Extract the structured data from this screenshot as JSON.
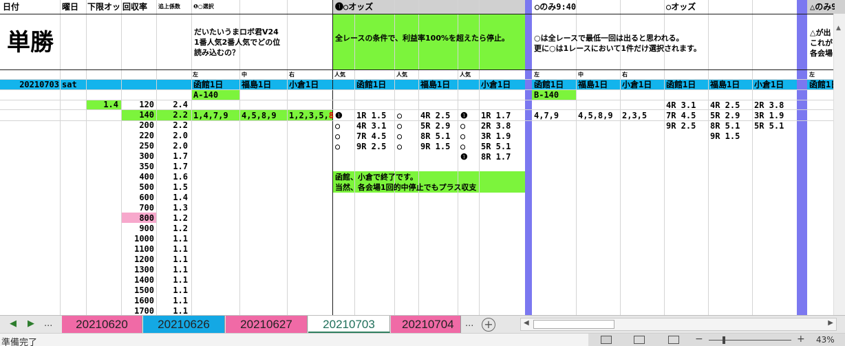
{
  "headers": {
    "date": "日付",
    "weekday": "曜日",
    "lower_limit": "下限オッ",
    "recovery": "回収率",
    "coef": "追上係数",
    "selection1": "❶○選択",
    "odds1": "❶○オッズ",
    "only940": "○のみ9:40",
    "odds2": "○オッズ",
    "only_tri": "△のみ9"
  },
  "title": "単勝",
  "notes": {
    "robo": [
      "だいたいうまロボ君V24",
      "1番人気2番人気でどの位",
      "読み込むの？"
    ],
    "stop": "全レースの条件で、利益率100%を超えたら停止。",
    "circle": [
      "○は全レースで最低一回は出ると思われる。",
      "更に○は1レースにおいて1件だけ選択されます。"
    ],
    "tri": [
      "△が出",
      "これが",
      "各会場"
    ],
    "end1": "函館、小倉で終了です。",
    "end2": "当然、各会場1回的中停止でもプラス収支"
  },
  "subheaders": {
    "left": "左",
    "mid": "中",
    "right": "右",
    "pop": "人気",
    "hakodate": "函館1日",
    "fukushima": "福島1日",
    "kokura": "小倉1日"
  },
  "day": {
    "date": "20210703",
    "weekday": "sat"
  },
  "labels": {
    "a140": "A-140",
    "b140": "B-140"
  },
  "lower_limit_value": "1.4",
  "recovery_rows": [
    {
      "r": "120",
      "c": "2.4"
    },
    {
      "r": "140",
      "c": "2.2"
    },
    {
      "r": "200",
      "c": "2.2"
    },
    {
      "r": "220",
      "c": "2.0"
    },
    {
      "r": "250",
      "c": "2.0"
    },
    {
      "r": "300",
      "c": "1.7"
    },
    {
      "r": "350",
      "c": "1.7"
    },
    {
      "r": "400",
      "c": "1.6"
    },
    {
      "r": "500",
      "c": "1.5"
    },
    {
      "r": "600",
      "c": "1.4"
    },
    {
      "r": "700",
      "c": "1.3"
    },
    {
      "r": "800",
      "c": "1.2"
    },
    {
      "r": "900",
      "c": "1.2"
    },
    {
      "r": "1000",
      "c": "1.1"
    },
    {
      "r": "1100",
      "c": "1.1"
    },
    {
      "r": "1200",
      "c": "1.1"
    },
    {
      "r": "1300",
      "c": "1.1"
    },
    {
      "r": "1400",
      "c": "1.1"
    },
    {
      "r": "1500",
      "c": "1.1"
    },
    {
      "r": "1600",
      "c": "1.1"
    },
    {
      "r": "1700",
      "c": "1.1"
    }
  ],
  "picks": {
    "h": "1,4,7,9",
    "f": "4,5,8,9",
    "k_prefix": "1,2,3,5,",
    "k_red": "8"
  },
  "odds_rows": [
    {
      "hp": "❶",
      "h": "1R 1.5",
      "fp": "○",
      "f": "4R 2.5",
      "kp": "❶",
      "k": "1R 1.7"
    },
    {
      "hp": "○",
      "h": "4R 3.1",
      "fp": "○",
      "f": "5R 2.9",
      "kp": "○",
      "k": "2R 3.8"
    },
    {
      "hp": "○",
      "h": "7R 4.5",
      "fp": "○",
      "f": "8R 5.1",
      "kp": "○",
      "k": "3R 1.9"
    },
    {
      "hp": "○",
      "h": "9R 2.5",
      "fp": "○",
      "f": "9R 1.5",
      "kp": "○",
      "k": "5R 5.1"
    },
    {
      "hp": "",
      "h": "",
      "fp": "",
      "f": "",
      "kp": "❶",
      "k": "8R 1.7"
    }
  ],
  "picks2": {
    "h": "4,7,9",
    "f": "4,5,8,9",
    "k": "2,3,5"
  },
  "odds2_h": [
    "4R 3.1",
    "7R 4.5",
    "9R 2.5"
  ],
  "odds2_f": [
    "4R 2.5",
    "5R 2.9",
    "8R 5.1",
    "9R 1.5"
  ],
  "odds2_k": [
    "2R 3.8",
    "3R 1.9",
    "5R 5.1"
  ],
  "tabs": [
    "20210620",
    "20210626",
    "20210627",
    "20210703",
    "20210704"
  ],
  "tab_more": "...",
  "status": "準備完了",
  "zoom": "43%",
  "nav": {
    "prev": "◀",
    "next": "▶",
    "more": "..."
  },
  "add_sheet": "+",
  "colors": {
    "lime": "#7cf43c",
    "cyan": "#13b4ec",
    "pink": "#f7a8cc",
    "purple": "#7b78f0"
  }
}
